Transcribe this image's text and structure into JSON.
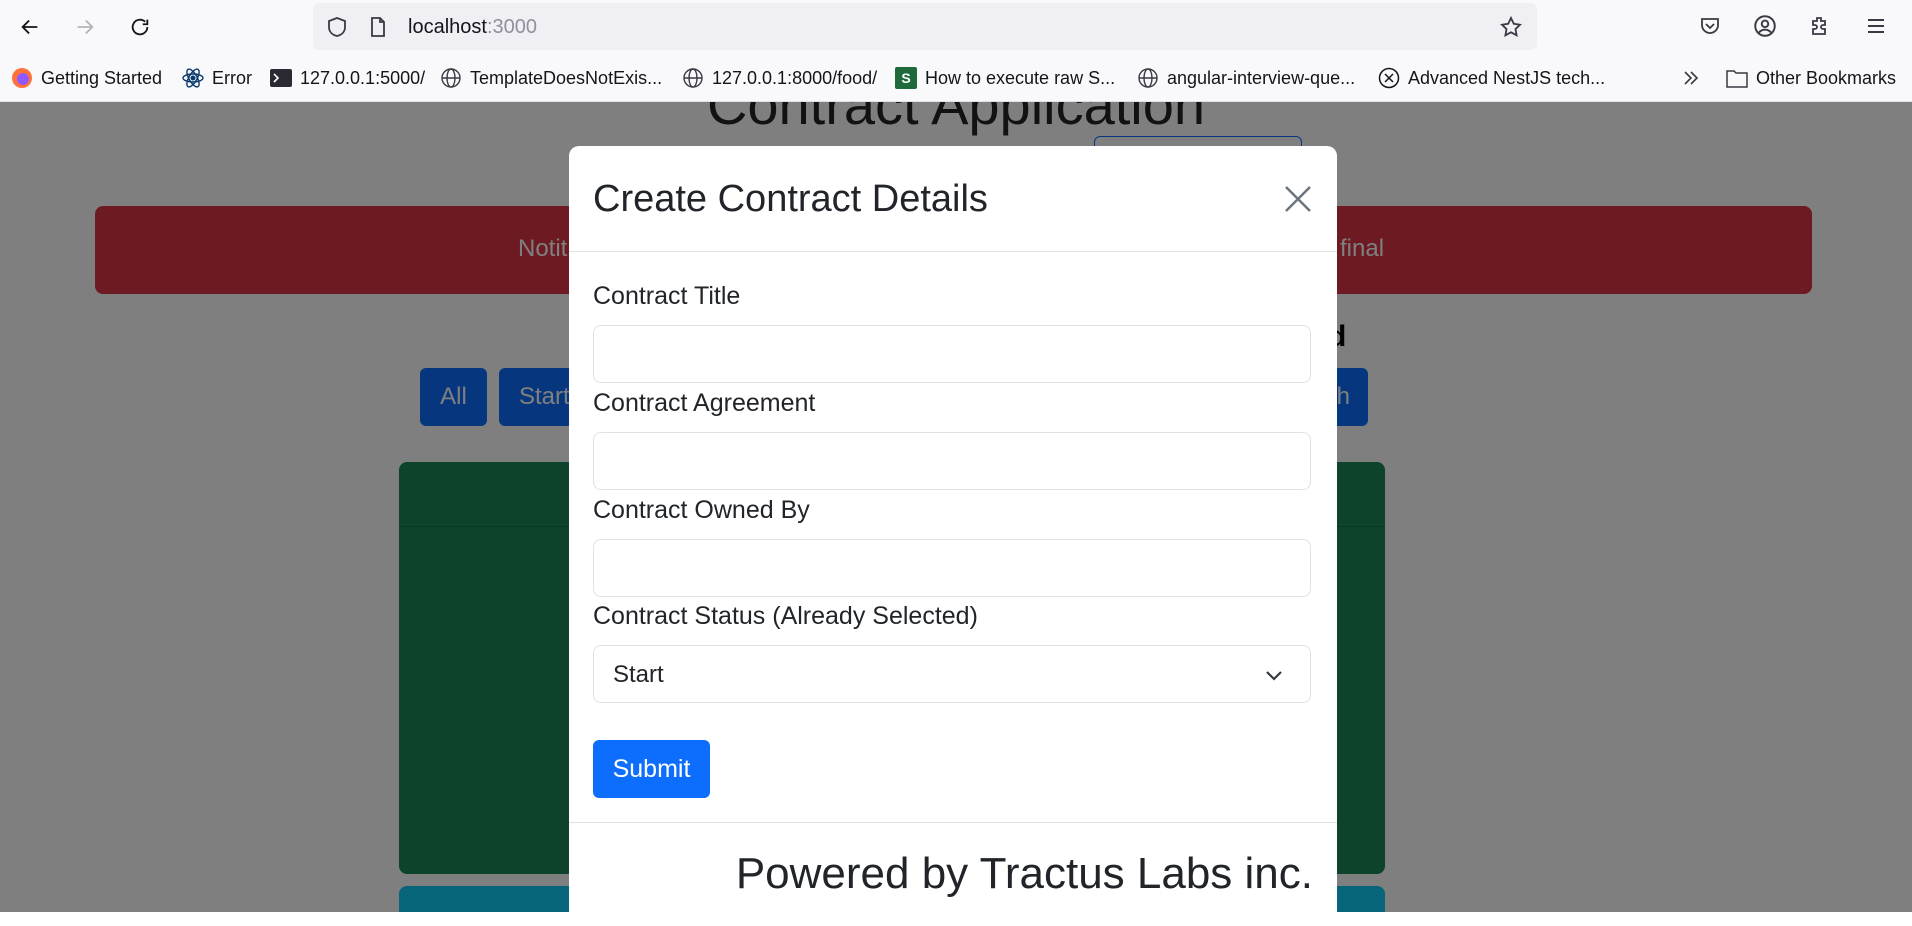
{
  "browser": {
    "url_host": "localhost",
    "url_port": ":3000",
    "bookmarks": [
      {
        "label": "Getting Started",
        "icon": "firefox-icon"
      },
      {
        "label": "Error",
        "icon": "react-icon"
      },
      {
        "label": "127.0.0.1:5000/",
        "icon": "terminal-icon"
      },
      {
        "label": "TemplateDoesNotExis...",
        "icon": "globe-icon"
      },
      {
        "label": "127.0.0.1:8000/food/",
        "icon": "globe-icon"
      },
      {
        "label": "How to execute raw S...",
        "icon": "s-icon"
      },
      {
        "label": "angular-interview-que...",
        "icon": "globe-icon"
      },
      {
        "label": "Advanced NestJS tech...",
        "icon": "x-icon"
      }
    ],
    "other_bookmarks": "Other Bookmarks"
  },
  "page": {
    "heading": "Contract Application",
    "alert_left": "Notit",
    "alert_right": "final",
    "subheading_fragment": "d",
    "filter_all": "All",
    "filter_start": "Start",
    "filter_right_fragment": "h"
  },
  "modal": {
    "title": "Create Contract Details",
    "fields": {
      "title_label": "Contract Title",
      "title_value": "",
      "agreement_label": "Contract Agreement",
      "agreement_value": "",
      "owner_label": "Contract Owned By",
      "owner_value": "",
      "status_label": "Contract Status (Already Selected)",
      "status_value": "Start"
    },
    "submit_label": "Submit",
    "footer_text": "Powered by Tractus Labs inc."
  },
  "colors": {
    "primary": "#0d6efd",
    "danger": "#dc3545",
    "success": "#198754",
    "info": "#0dcaf0"
  }
}
